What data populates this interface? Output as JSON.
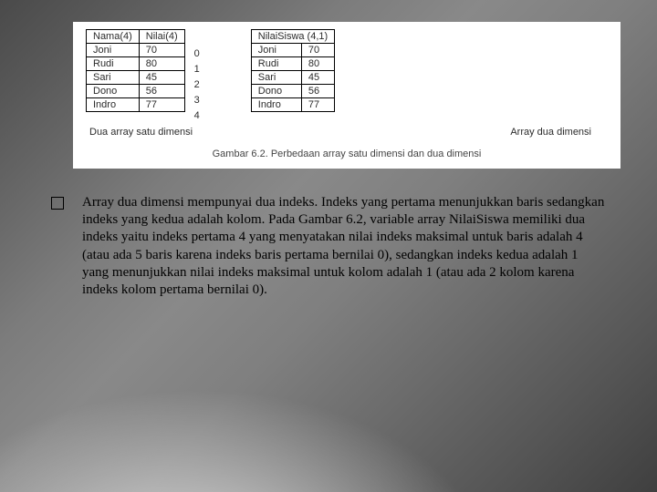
{
  "figure": {
    "table_left": {
      "headers": [
        "Nama(4)",
        "Nilai(4)"
      ],
      "rows": [
        [
          "Joni",
          "70"
        ],
        [
          "Rudi",
          "80"
        ],
        [
          "Sari",
          "45"
        ],
        [
          "Dono",
          "56"
        ],
        [
          "Indro",
          "77"
        ]
      ],
      "caption": "Dua array satu dimensi"
    },
    "index_column": [
      "0",
      "1",
      "2",
      "3",
      "4"
    ],
    "table_right": {
      "headers": [
        "NilaiSiswa (4,1)",
        ""
      ],
      "rows": [
        [
          "Joni",
          "70"
        ],
        [
          "Rudi",
          "80"
        ],
        [
          "Sari",
          "45"
        ],
        [
          "Dono",
          "56"
        ],
        [
          "Indro",
          "77"
        ]
      ],
      "caption": "Array dua dimensi"
    },
    "main_caption": "Gambar 6.2.  Perbedaan array satu dimensi dan dua dimensi"
  },
  "body": {
    "paragraph": "Array dua dimensi mempunyai dua indeks. Indeks yang pertama menunjukkan baris sedangkan indeks yang kedua adalah kolom. Pada Gambar 6.2, variable array NilaiSiswa memiliki dua indeks yaitu indeks pertama 4 yang menyatakan nilai indeks maksimal untuk baris adalah 4 (atau ada 5 baris karena indeks baris pertama bernilai 0), sedangkan indeks kedua adalah 1 yang menunjukkan nilai indeks maksimal untuk kolom adalah 1 (atau ada 2 kolom karena indeks kolom pertama bernilai 0)."
  }
}
